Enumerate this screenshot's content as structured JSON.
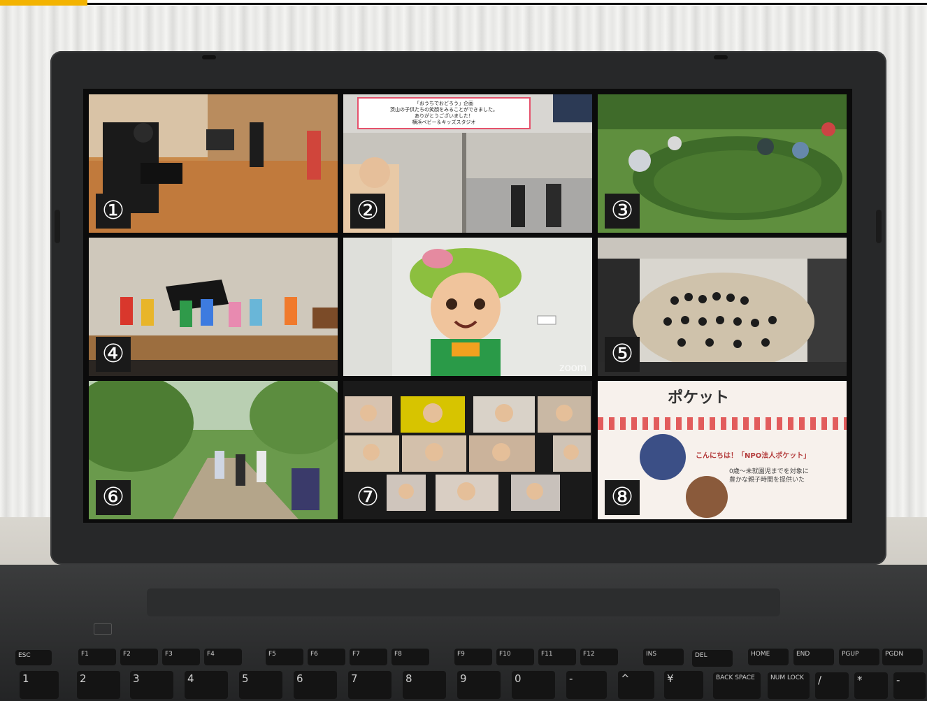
{
  "panels": [
    {
      "label": "①",
      "scene": "hall-camera"
    },
    {
      "label": "②",
      "scene": "video-call-room",
      "caption": [
        "「おうちでおどろう」企画",
        "茨山の子供たちの笑顔をみることができました。",
        "ありがとうございました！",
        "横浜ベビー＆キッズスタジオ"
      ]
    },
    {
      "label": "③",
      "scene": "garden"
    },
    {
      "label": "④",
      "scene": "stage-dancers"
    },
    {
      "label": "",
      "scene": "mascot",
      "watermark": "zoom"
    },
    {
      "label": "⑤",
      "scene": "orchestra"
    },
    {
      "label": "⑥",
      "scene": "park-walk"
    },
    {
      "label": "⑦",
      "scene": "zoom-grid"
    },
    {
      "label": "⑧",
      "scene": "pocket-flyer",
      "title": "ポケット",
      "headline": "こんにちは！「NPO法人ポケット」",
      "line1": "0歳～未就園児までを対象に",
      "line2": "豊かな親子時間を提供いた"
    }
  ],
  "keyboard": {
    "function_keys": [
      "ESC",
      "F1",
      "F2",
      "F3",
      "F4",
      "F5",
      "F6",
      "F7",
      "F8",
      "F9",
      "F10",
      "F11",
      "F12",
      "INS",
      "DEL",
      "HOME",
      "END",
      "PGUP",
      "PGDN"
    ],
    "number_keys": [
      "1",
      "2",
      "3",
      "4",
      "5",
      "6",
      "7",
      "8",
      "9",
      "0",
      "-",
      "^",
      "¥",
      "BACK SPACE",
      "NUM LOCK",
      "/",
      "*",
      "-"
    ]
  },
  "colors": {
    "accent_bar": "#f3b300",
    "bezel": "#272829",
    "screen_bg": "#0b0b0b"
  }
}
